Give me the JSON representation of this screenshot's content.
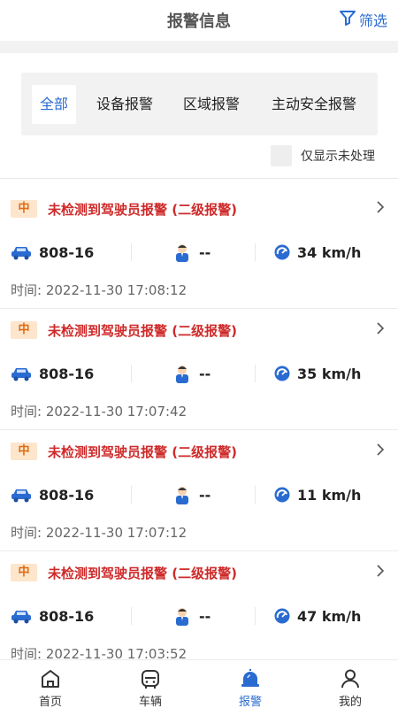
{
  "header": {
    "title": "报警信息",
    "filter_label": "筛选"
  },
  "tabs": [
    {
      "label": "全部",
      "active": true
    },
    {
      "label": "设备报警",
      "active": false
    },
    {
      "label": "区域报警",
      "active": false
    },
    {
      "label": "主动安全报警",
      "active": false
    }
  ],
  "filter_toggle": {
    "label": "仅显示未处理",
    "checked": false
  },
  "alarms": [
    {
      "level": "中",
      "title": "未检测到驾驶员报警 (二级报警)",
      "plate": "808-16",
      "driver": "--",
      "speed": "34 km/h",
      "time": "时间: 2022-11-30 17:08:12"
    },
    {
      "level": "中",
      "title": "未检测到驾驶员报警 (二级报警)",
      "plate": "808-16",
      "driver": "--",
      "speed": "35 km/h",
      "time": "时间: 2022-11-30 17:07:42"
    },
    {
      "level": "中",
      "title": "未检测到驾驶员报警 (二级报警)",
      "plate": "808-16",
      "driver": "--",
      "speed": "11 km/h",
      "time": "时间: 2022-11-30 17:07:12"
    },
    {
      "level": "中",
      "title": "未检测到驾驶员报警 (二级报警)",
      "plate": "808-16",
      "driver": "--",
      "speed": "47 km/h",
      "time": "时间: 2022-11-30 17:03:52"
    }
  ],
  "nav": [
    {
      "label": "首页",
      "icon": "home-icon",
      "active": false
    },
    {
      "label": "车辆",
      "icon": "vehicle-icon",
      "active": false
    },
    {
      "label": "报警",
      "icon": "alarm-bell-icon",
      "active": true
    },
    {
      "label": "我的",
      "icon": "user-icon",
      "active": false
    }
  ],
  "colors": {
    "accent": "#2a6bd1",
    "alarm_red": "#cf2a2a",
    "badge_bg": "#fde6cc",
    "badge_text": "#e06a12"
  }
}
